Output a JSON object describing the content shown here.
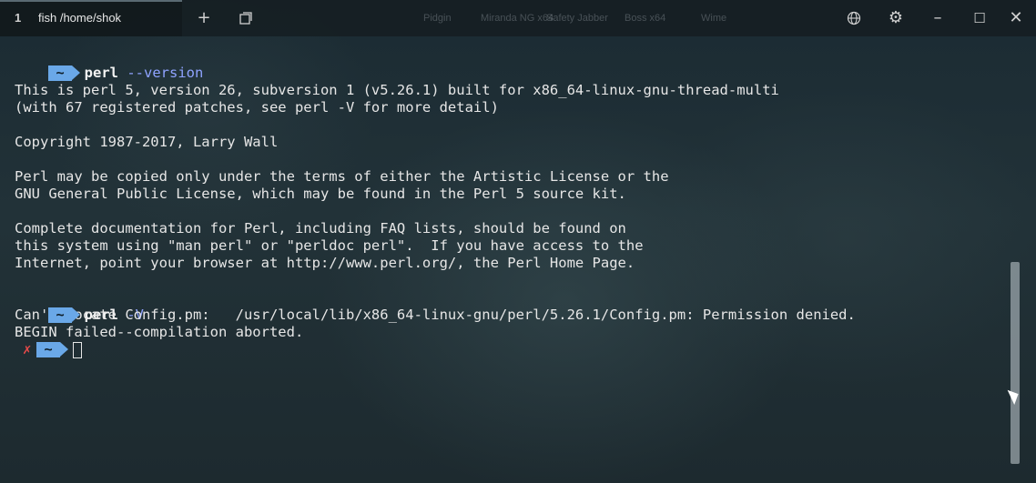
{
  "window": {
    "tab_index": "1",
    "tab_title": "fish /home/shok",
    "new_tab_icon": "plus-icon",
    "tab_switcher_icon": "tabs-icon",
    "globe_icon": "globe-icon",
    "settings_icon": "gear-icon",
    "minimize_icon": "minimize-icon",
    "maximize_icon": "maximize-icon",
    "close_icon": "close-icon",
    "background_desktop_labels": [
      "Pidgin",
      "Miranda NG x64",
      "Safety Jabber",
      "Boss x64",
      "Wime"
    ]
  },
  "terminal": {
    "prompt_dir": "~",
    "commands": [
      {
        "cmd": "perl",
        "args": "--version"
      },
      {
        "cmd": "perl",
        "args": "-V"
      }
    ],
    "output1": [
      "This is perl 5, version 26, subversion 1 (v5.26.1) built for x86_64-linux-gnu-thread-multi",
      "(with 67 registered patches, see perl -V for more detail)",
      "",
      "Copyright 1987-2017, Larry Wall",
      "",
      "Perl may be copied only under the terms of either the Artistic License or the",
      "GNU General Public License, which may be found in the Perl 5 source kit.",
      "",
      "Complete documentation for Perl, including FAQ lists, should be found on",
      "this system using \"man perl\" or \"perldoc perl\".  If you have access to the",
      "Internet, point your browser at http://www.perl.org/, the Perl Home Page."
    ],
    "output2": [
      "Can't locate Config.pm:   /usr/local/lib/x86_64-linux-gnu/perl/5.26.1/Config.pm: Permission denied.",
      "BEGIN failed--compilation aborted."
    ],
    "error_marker": "✗"
  },
  "colors": {
    "prompt_badge": "#6aa8e8",
    "arg": "#8fa3ff",
    "error": "#e84a4a"
  }
}
